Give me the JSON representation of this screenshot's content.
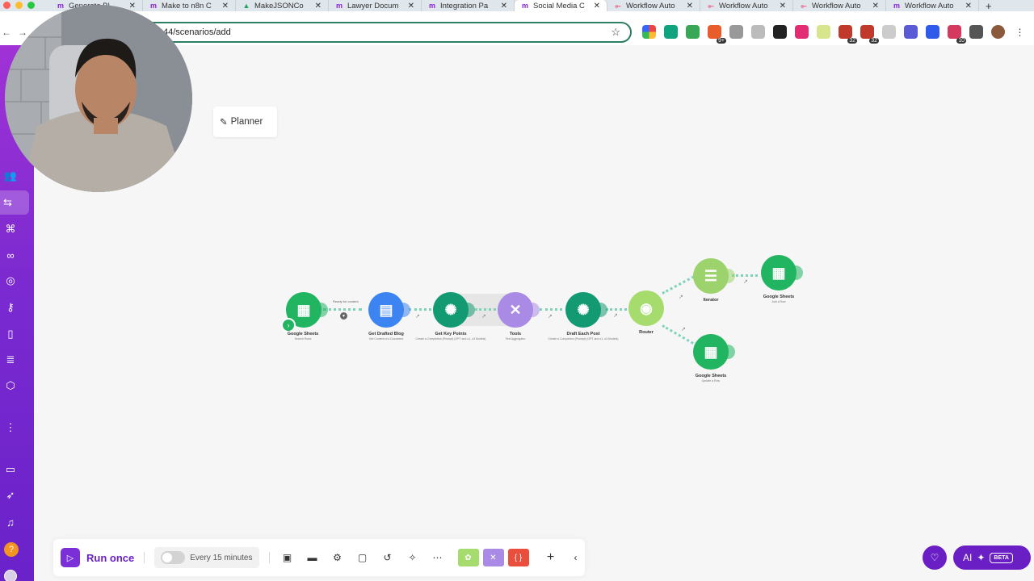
{
  "browser": {
    "tabs": [
      {
        "label": "Generate Bl",
        "icon": "make-icon",
        "active": false
      },
      {
        "label": "Make to n8n C",
        "icon": "make-icon",
        "active": false
      },
      {
        "label": "MakeJSONCo",
        "icon": "drive-icon",
        "active": false
      },
      {
        "label": "Lawyer Docum",
        "icon": "make-icon",
        "active": false
      },
      {
        "label": "Integration Pa",
        "icon": "make-icon",
        "active": false
      },
      {
        "label": "Social Media C",
        "icon": "make-icon",
        "active": true
      },
      {
        "label": "Workflow Auto",
        "icon": "n8n-icon",
        "active": false
      },
      {
        "label": "Workflow Auto",
        "icon": "n8n-icon",
        "active": false
      },
      {
        "label": "Workflow Auto",
        "icon": "n8n-icon",
        "active": false
      },
      {
        "label": "Workflow Auto",
        "icon": "make-icon",
        "active": false
      }
    ],
    "new_tab": "+",
    "url": "44/scenarios/add",
    "extension_badges": [
      "9+",
      "32",
      "32",
      "10"
    ]
  },
  "canvas": {
    "planner_label": "Planner"
  },
  "scenario": {
    "modules": [
      {
        "name": "Google Sheets",
        "sub": "Search Rows",
        "type": "sheets"
      },
      {
        "name": "Get Drafted Blog",
        "sub": "Get Content of a Document",
        "type": "docs"
      },
      {
        "name": "Get Key Points",
        "sub": "Create a Completion (Prompt) (GPT and o1, o3 Models)",
        "type": "gpt"
      },
      {
        "name": "Tools",
        "sub": "Text Aggregator",
        "type": "tools"
      },
      {
        "name": "Draft Each Post",
        "sub": "Create a Completion (Prompt) (GPT and o1, o3 Models)",
        "type": "gpt"
      },
      {
        "name": "Router",
        "sub": "",
        "type": "router"
      },
      {
        "name": "Iterator",
        "sub": "",
        "type": "iter"
      },
      {
        "name": "Google Sheets",
        "sub": "Add a Row",
        "type": "sheets"
      },
      {
        "name": "Google Sheets",
        "sub": "Update a Row",
        "type": "sheets"
      }
    ],
    "filter_note": "Ready for content"
  },
  "bottom_toolbar": {
    "run_label": "Run once",
    "schedule_label": "Every 15 minutes",
    "schedule_on": false
  },
  "ai": {
    "label": "AI",
    "badge": "BETA"
  },
  "colors": {
    "sidebar_top": "#a032d6",
    "sidebar_bottom": "#6a22c9",
    "brand_purple": "#6a1fc5",
    "sheets_green": "#21b561",
    "docs_blue": "#3d84f3",
    "openai_green": "#149a73",
    "tools_purple": "#a98be6",
    "router_green": "#a6db6e"
  }
}
